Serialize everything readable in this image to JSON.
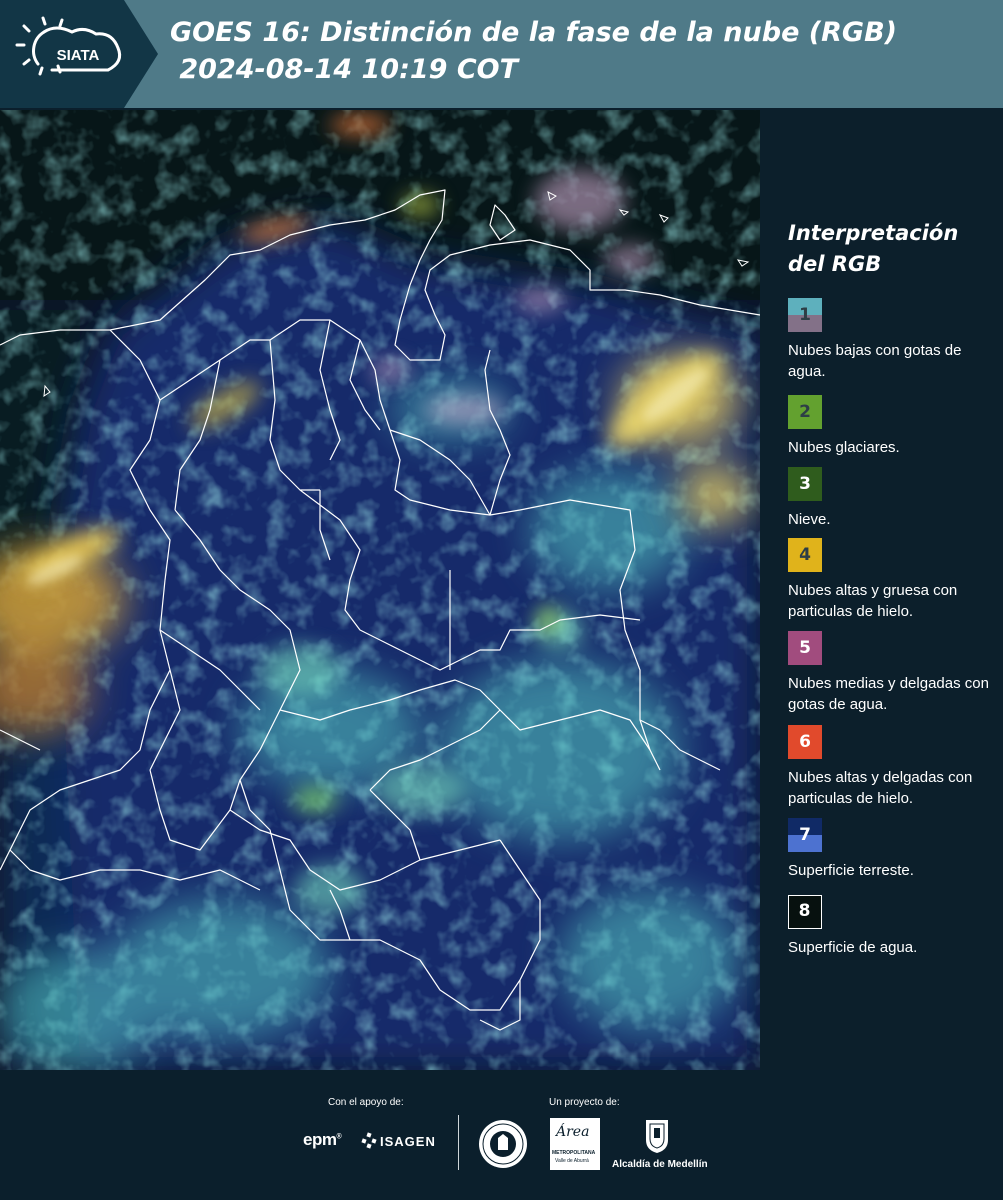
{
  "header": {
    "logo_text": "SIATA",
    "title_line1": "GOES 16: Distinción de la fase de la nube (RGB)",
    "title_line2": " 2024-08-14 10:19 COT",
    "background_color": "#4f7a88"
  },
  "legend": {
    "title": "Interpretación del RGB",
    "items": [
      {
        "number": "1",
        "label": "Nubes bajas con gotas de agua.",
        "color_top": "#5eb0bd",
        "color_bottom": "#837188"
      },
      {
        "number": "2",
        "label": "Nubes glaciares.",
        "color": "#63a12f"
      },
      {
        "number": "3",
        "label": "Nieve.",
        "color": "#2f5c1d"
      },
      {
        "number": "4",
        "label": "Nubes altas y gruesa con particulas de hielo.",
        "color": "#e0b31b"
      },
      {
        "number": "5",
        "label": "Nubes medias y delgadas con gotas de agua.",
        "color": "#a14c7e"
      },
      {
        "number": "6",
        "label": "Nubes altas y delgadas con particulas de hielo.",
        "color": "#e14a2c"
      },
      {
        "number": "7",
        "label": "Superficie terreste.",
        "color_top": "#102a66",
        "color_bottom": "#4d72d0"
      },
      {
        "number": "8",
        "label": "Superficie de agua.",
        "color": "#07110f"
      }
    ]
  },
  "footer": {
    "support_label": "Con el apoyo de:",
    "project_label": "Un proyecto de:",
    "sponsor_epm": "epm",
    "sponsor_isagen": "ISAGEN",
    "area_metro_name": "Área",
    "area_metro_sub1": "METROPOLITANA",
    "area_metro_sub2": "Valle de Aburrá",
    "alcaldia": "Alcaldía de Medellín"
  }
}
